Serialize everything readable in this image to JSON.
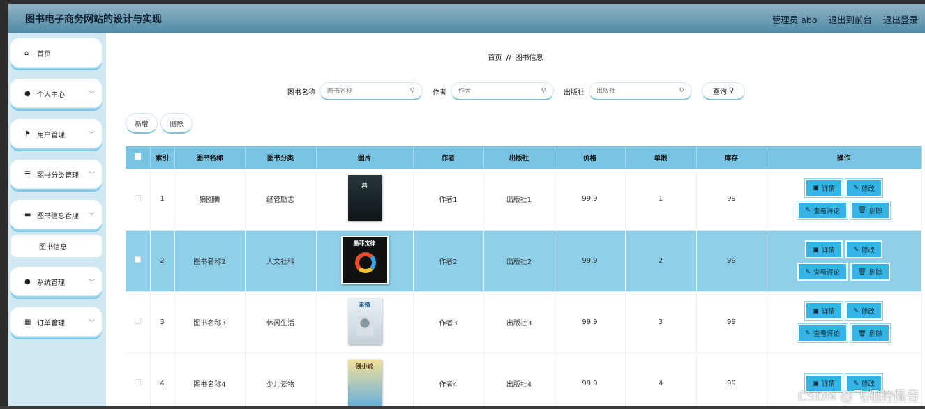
{
  "header": {
    "title": "图书电子商务网站的设计与实现",
    "user": "管理员 abo",
    "to_front": "退出到前台",
    "logout": "退出登录"
  },
  "sidebar": {
    "items": [
      {
        "label": "首页",
        "icon": "home-icon"
      },
      {
        "label": "个人中心",
        "icon": "user-icon"
      },
      {
        "label": "用户管理",
        "icon": "flag-icon"
      },
      {
        "label": "图书分类管理",
        "icon": "sliders-icon"
      },
      {
        "label": "图书信息管理",
        "icon": "message-icon"
      },
      {
        "label": "系统管理",
        "icon": "user-icon"
      },
      {
        "label": "订单管理",
        "icon": "grid-icon"
      }
    ],
    "submenu_label": "图书信息"
  },
  "breadcrumb": {
    "home": "首页",
    "sep": "//",
    "current": "图书信息"
  },
  "search": {
    "name_label": "图书名称",
    "name_placeholder": "图书名称",
    "author_label": "作者",
    "author_placeholder": "作者",
    "publisher_label": "出版社",
    "publisher_placeholder": "出版社",
    "query_label": "查询"
  },
  "actions": {
    "add": "新增",
    "delete": "删除"
  },
  "table": {
    "headers": [
      "索引",
      "图书名称",
      "图书分类",
      "图片",
      "作者",
      "出版社",
      "价格",
      "单限",
      "库存",
      "操作"
    ],
    "rows": [
      {
        "index": "1",
        "name": "狼图腾",
        "category": "经管励志",
        "cover_text": "典",
        "author": "作者1",
        "publisher": "出版社1",
        "price": "99.9",
        "limit": "1",
        "stock": "99"
      },
      {
        "index": "2",
        "name": "图书名称2",
        "category": "人文社科",
        "cover_text": "墨菲定律",
        "author": "作者2",
        "publisher": "出版社2",
        "price": "99.9",
        "limit": "2",
        "stock": "99"
      },
      {
        "index": "3",
        "name": "图书名称3",
        "category": "休闲生活",
        "cover_text": "素描",
        "author": "作者3",
        "publisher": "出版社3",
        "price": "99.9",
        "limit": "3",
        "stock": "99"
      },
      {
        "index": "4",
        "name": "图书名称4",
        "category": "少儿读物",
        "cover_text": "漫小说",
        "author": "作者4",
        "publisher": "出版社4",
        "price": "99.9",
        "limit": "4",
        "stock": "99"
      }
    ],
    "ops": {
      "detail": "详情",
      "edit": "修改",
      "comments": "查看评论",
      "delete": "删除"
    }
  },
  "watermark": "CSDN @飞翔的佩奇"
}
